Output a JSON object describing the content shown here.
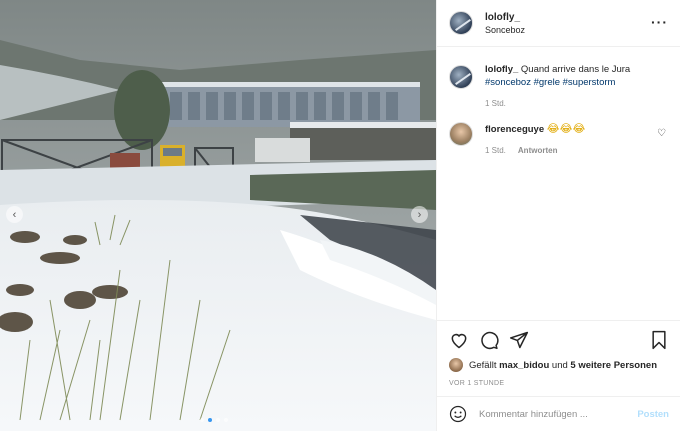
{
  "header": {
    "username": "lolofly_",
    "location": "Sonceboz",
    "more_icon": "more-horizontal-icon"
  },
  "caption": {
    "username": "lolofly_",
    "text": "Quand arrive dans le Jura",
    "hashtags": "#sonceboz #grele #superstorm",
    "time": "1 Std."
  },
  "comments": [
    {
      "username": "florenceguye",
      "text": "😂😂😂",
      "time": "1 Std.",
      "reply_label": "Antworten"
    }
  ],
  "likes": {
    "prefix": "Gefällt",
    "user": "max_bidou",
    "middle": "und",
    "others": "5 weitere Personen"
  },
  "date": "VOR 1 STUNDE",
  "add_comment": {
    "placeholder": "Kommentar hinzufügen ...",
    "post_label": "Posten"
  },
  "media": {
    "prev_icon": "chevron-left-icon",
    "next_icon": "chevron-right-icon",
    "slides": 4,
    "active_slide": 2
  },
  "colors": {
    "link": "#00376b",
    "meta": "#8e8e8e",
    "post_button": "#b2dffc",
    "active_dot": "#3897f0"
  }
}
